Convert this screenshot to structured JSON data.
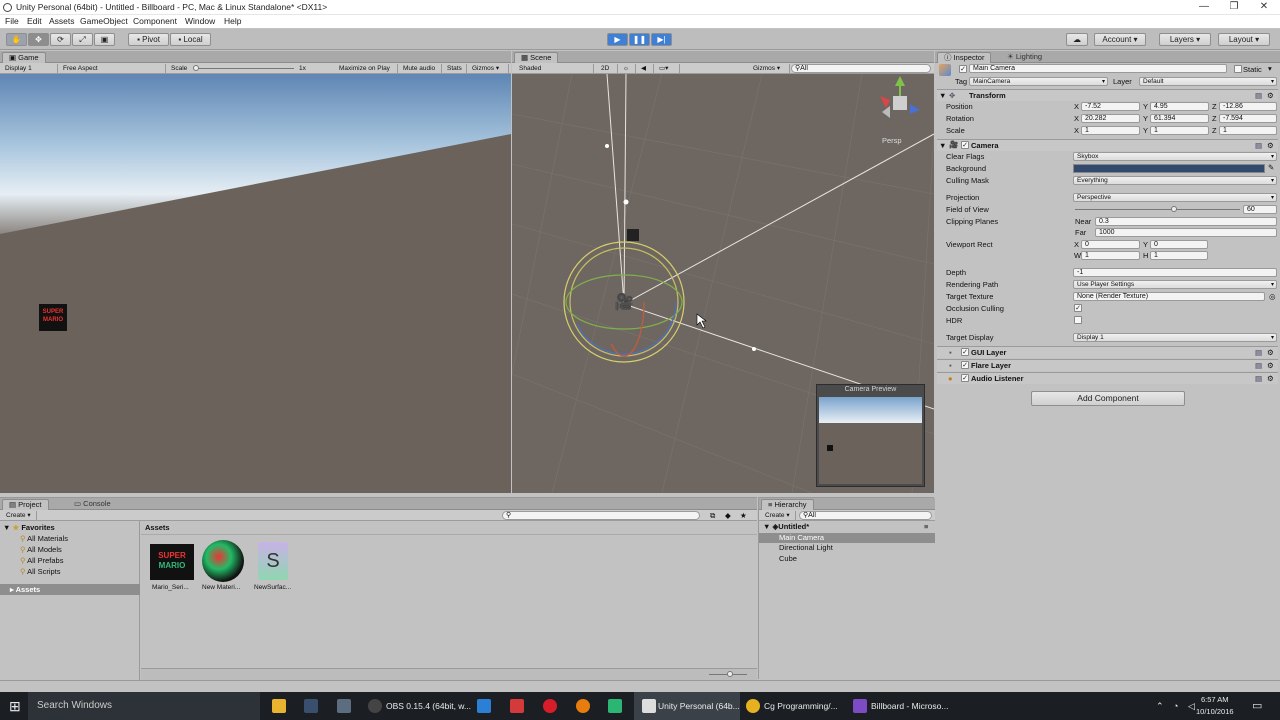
{
  "window": {
    "title": "Unity Personal (64bit) - Untitled - Billboard - PC, Mac & Linux Standalone* <DX11>",
    "minimize": "—",
    "maximize": "❐",
    "close": "✕"
  },
  "menu": [
    "File",
    "Edit",
    "Assets",
    "GameObject",
    "Component",
    "Window",
    "Help"
  ],
  "toolbar": {
    "pivot": "Pivot",
    "local": "Local",
    "account": "Account",
    "layers": "Layers",
    "layout": "Layout",
    "cloud_icon": "cloud-icon",
    "play_icon": "play-icon",
    "pause_icon": "pause-icon",
    "step_icon": "step-icon"
  },
  "game": {
    "tab": "Game",
    "display": "Display 1",
    "aspect": "Free Aspect",
    "scale_label": "Scale",
    "scale_value": "1x",
    "maximize": "Maximize on Play",
    "mute": "Mute audio",
    "stats": "Stats",
    "gizmos": "Gizmos",
    "sky_top": "#8fb4d4",
    "ground": "#6b625b"
  },
  "scene": {
    "tab": "Scene",
    "shading": "Shaded",
    "mode2d": "2D",
    "gizmos": "Gizmos",
    "search": "All",
    "persp": "Persp",
    "preview_title": "Camera Preview"
  },
  "inspector": {
    "tab": "Inspector",
    "tab2": "Lighting",
    "object_name": "Main Camera",
    "static": "Static",
    "tag_label": "Tag",
    "tag": "MainCamera",
    "layer_label": "Layer",
    "layer": "Default",
    "transform": {
      "title": "Transform",
      "position": "Position",
      "rotation": "Rotation",
      "scale": "Scale",
      "pos": [
        "-7.52",
        "4.95",
        "-12.86"
      ],
      "rot": [
        "20.282",
        "61.394",
        "-7.594"
      ],
      "scl": [
        "1",
        "1",
        "1"
      ]
    },
    "camera": {
      "title": "Camera",
      "clear_flags": "Clear Flags",
      "clear_flags_value": "Skybox",
      "background": "Background",
      "background_color": "#324a6e",
      "culling_mask": "Culling Mask",
      "culling_mask_value": "Everything",
      "projection": "Projection",
      "projection_value": "Perspective",
      "fov": "Field of View",
      "fov_value": "60",
      "fov_fraction": 0.6,
      "clipping": "Clipping Planes",
      "near_label": "Near",
      "near": "0.3",
      "far_label": "Far",
      "far": "1000",
      "viewport": "Viewport Rect",
      "vx": "0",
      "vy": "0",
      "vw": "1",
      "vh": "1",
      "depth": "Depth",
      "depth_value": "-1",
      "rendering_path": "Rendering Path",
      "rendering_path_value": "Use Player Settings",
      "target_texture": "Target Texture",
      "target_texture_value": "None (Render Texture)",
      "occlusion": "Occlusion Culling",
      "hdr": "HDR",
      "target_display": "Target Display",
      "target_display_value": "Display 1"
    },
    "components": [
      "GUI Layer",
      "Flare Layer",
      "Audio Listener"
    ],
    "add_component": "Add Component"
  },
  "project": {
    "tab": "Project",
    "tab2": "Console",
    "create": "Create",
    "favorites": "Favorites",
    "fav_items": [
      "All Materials",
      "All Models",
      "All Prefabs",
      "All Scripts"
    ],
    "assets_root": "Assets",
    "assets_header": "Assets",
    "assets": [
      "Mario_Seri...",
      "New Materi...",
      "NewSurfac..."
    ]
  },
  "hierarchy": {
    "tab": "Hierarchy",
    "create": "Create",
    "search": "All",
    "scene": "Untitled*",
    "items": [
      "Main Camera",
      "Directional Light",
      "Cube"
    ]
  },
  "taskbar": {
    "search": "Search Windows",
    "obs": "OBS 0.15.4 (64bit, w...",
    "unity": "Unity Personal (64b...",
    "chrome": "Cg Programming/...",
    "vs": "Billboard - Microso...",
    "time": "6:57 AM",
    "date": "10/10/2016"
  }
}
